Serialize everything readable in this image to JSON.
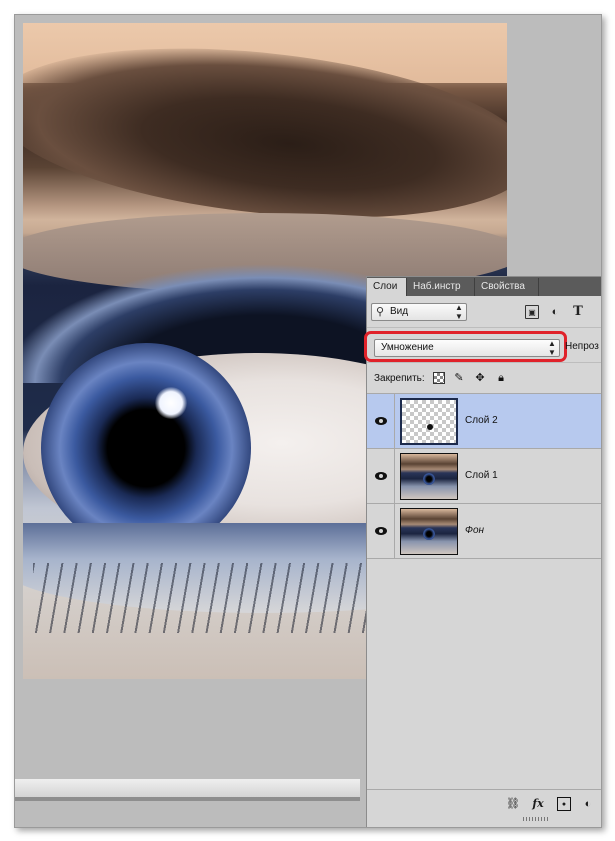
{
  "panel": {
    "tabs": [
      {
        "label": "Слои",
        "active": true
      },
      {
        "label": "Наб.инстр",
        "active": false
      },
      {
        "label": "Свойства",
        "active": false
      }
    ],
    "filter": {
      "value": "Вид",
      "icon": "search-icon"
    },
    "filter_icons": [
      "image-filter-icon",
      "adjustment-filter-icon",
      "type-filter-icon"
    ],
    "blend_mode": {
      "value": "Умножение",
      "highlighted": true,
      "highlight_color": "#e0222a"
    },
    "opacity_label": "Непроз",
    "lock_label": "Закрепить:",
    "lock_icons": [
      "lock-transparent-icon",
      "lock-paint-icon",
      "lock-move-icon",
      "lock-all-icon"
    ],
    "layers": [
      {
        "name": "Слой 2",
        "selected": true,
        "visible": true,
        "thumbnail": "transparent"
      },
      {
        "name": "Слой 1",
        "selected": false,
        "visible": true,
        "thumbnail": "photo"
      },
      {
        "name": "Фон",
        "selected": false,
        "visible": true,
        "thumbnail": "photo",
        "italic": true
      }
    ],
    "footer_icons": [
      "link-icon",
      "fx-icon",
      "mask-icon",
      "adjustment-icon"
    ],
    "fx_label": "fx"
  },
  "colors": {
    "selected_row": "#b7c9ee",
    "panel_bg": "#d6d6d6",
    "tab_bar": "#5b5b5b"
  }
}
